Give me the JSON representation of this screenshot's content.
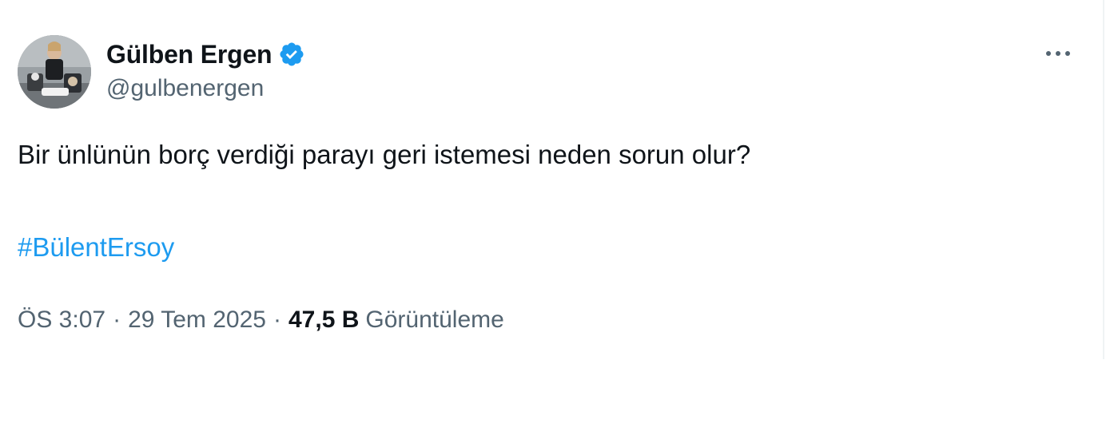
{
  "author": {
    "display_name": "Gülben Ergen",
    "handle": "@gulbenergen",
    "verified": true,
    "avatar_icon": "profile-photo",
    "verified_color": "#1d9bf0"
  },
  "tweet": {
    "text": "Bir ünlünün borç verdiği parayı geri istemesi neden sorun olur?",
    "hashtag": "#BülentErsoy",
    "time": "ÖS 3:07",
    "date": "29 Tem 2025",
    "separator": "·",
    "views_count": "47,5 B",
    "views_label": "Görüntüleme"
  },
  "actions": {
    "more_icon": "more-horizontal-icon"
  },
  "colors": {
    "link": "#1d9bf0",
    "primary_text": "#0f1419",
    "secondary_text": "#536471"
  }
}
